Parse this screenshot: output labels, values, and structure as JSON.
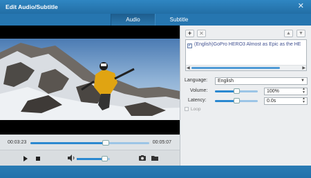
{
  "window": {
    "title": "Edit Audio/Subtitle",
    "close_glyph": "✕"
  },
  "tabs": [
    {
      "label": "Audio",
      "active": true
    },
    {
      "label": "Subtitle",
      "active": false
    }
  ],
  "player": {
    "current_time": "00:03:23",
    "total_time": "00:05:07",
    "progress_fraction": 0.66,
    "volume_fraction": 0.82
  },
  "audio_panel": {
    "toolbar": {
      "add_glyph": "+",
      "delete_glyph": "✕",
      "up_glyph": "▲",
      "down_glyph": "▼"
    },
    "tracks": [
      {
        "label": "(English)GoPro HERO3 Almost as Epic as the HE",
        "checked": true
      }
    ],
    "language": {
      "label": "Language:",
      "value": "English"
    },
    "volume": {
      "label": "Volume:",
      "value": "100%",
      "fraction": 0.5
    },
    "latency": {
      "label": "Latency:",
      "value": "0.0s",
      "fraction": 0.5
    },
    "loop": {
      "label": "Loop",
      "enabled": false
    }
  },
  "colors": {
    "accent": "#2a88d0",
    "titlebar": "#2a7cb5"
  }
}
